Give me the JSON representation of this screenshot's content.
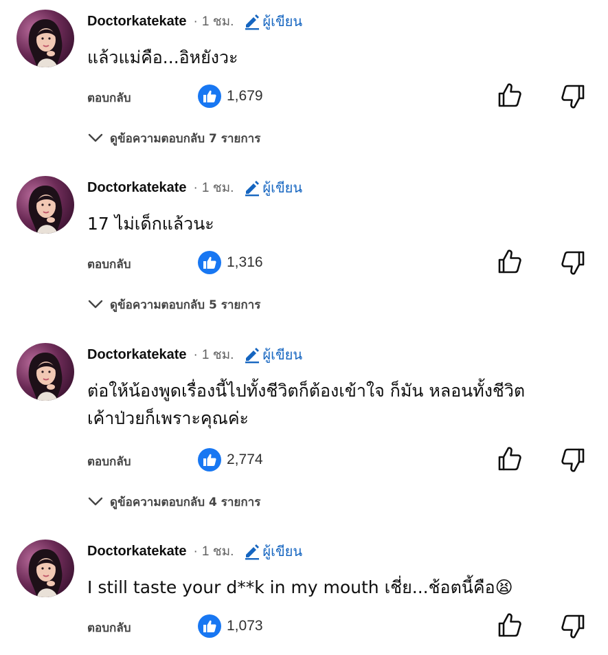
{
  "comments": [
    {
      "author": "Doctorkatekate",
      "time": "1 ชม.",
      "creator_label": "ผู้เขียน",
      "text": "แล้วแม่คือ...อิหยังวะ",
      "reply_label": "ตอบกลับ",
      "likes": "1,679",
      "replies_label": "ดูข้อความตอบกลับ 7 รายการ"
    },
    {
      "author": "Doctorkatekate",
      "time": "1 ชม.",
      "creator_label": "ผู้เขียน",
      "text": "17 ไม่เด็กแล้วนะ",
      "reply_label": "ตอบกลับ",
      "likes": "1,316",
      "replies_label": "ดูข้อความตอบกลับ 5 รายการ"
    },
    {
      "author": "Doctorkatekate",
      "time": "1 ชม.",
      "creator_label": "ผู้เขียน",
      "text": "ต่อให้น้องพูดเรื่องนี้ไปทั้งชีวิตก็ต้องเข้าใจ ก็มัน หลอนทั้งชีวิต\nเค้าป่วยก็เพราะคุณค่ะ",
      "reply_label": "ตอบกลับ",
      "likes": "2,774",
      "replies_label": "ดูข้อความตอบกลับ 4 รายการ"
    },
    {
      "author": "Doctorkatekate",
      "time": "1 ชม.",
      "creator_label": "ผู้เขียน",
      "text": "I still taste your d**k in my mouth เชี่ย...ช้อตนี้คือ",
      "emoji": "😫",
      "reply_label": "ตอบกลับ",
      "likes": "1,073"
    }
  ],
  "icons": {
    "creator": "pencil-icon",
    "like_badge": "facebook-like-icon",
    "like_button": "thumb-up-icon",
    "dislike_button": "thumb-down-icon",
    "expand": "chevron-down-icon"
  },
  "colors": {
    "creator_label": "#1565c0",
    "like_badge": "#1877f2",
    "secondary_text": "#606060",
    "text": "#0f0f0f"
  }
}
